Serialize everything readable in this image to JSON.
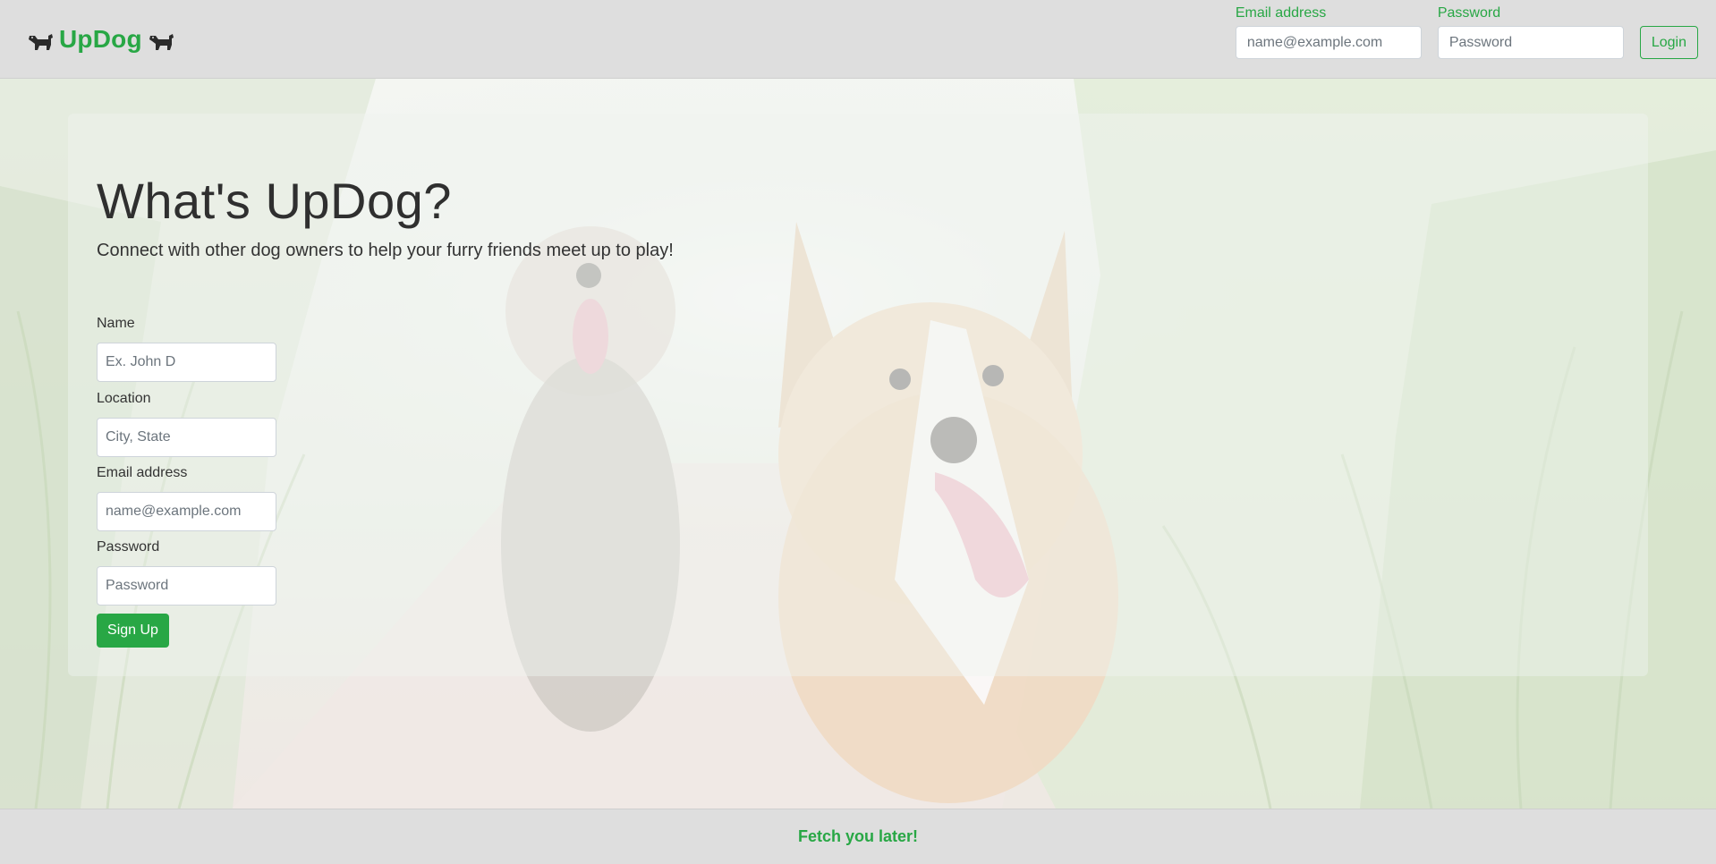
{
  "brand": {
    "name": "UpDog",
    "color": "#28a745",
    "left_icon": "dog-icon",
    "right_icon": "dog-icon"
  },
  "login_form": {
    "email_label": "Email address",
    "email_placeholder": "name@example.com",
    "email_value": "",
    "password_label": "Password",
    "password_placeholder": "Password",
    "password_value": "",
    "login_label": "Login"
  },
  "hero": {
    "title": "What's UpDog?",
    "subtitle": "Connect with other dog owners to help your furry friends meet up to play!",
    "background_image": "two-dogs-in-grass-photo"
  },
  "signup_form": {
    "name_label": "Name",
    "name_placeholder": "Ex. John D",
    "location_label": "Location",
    "location_placeholder": "City, State",
    "email_label": "Email address",
    "email_placeholder": "name@example.com",
    "password_label": "Password",
    "password_placeholder": "Password",
    "submit_label": "Sign Up"
  },
  "footer": {
    "text": "Fetch you later!"
  },
  "colors": {
    "accent": "#28a745",
    "navbar_bg": "#dedede",
    "text_dark": "#2f2f2f"
  }
}
